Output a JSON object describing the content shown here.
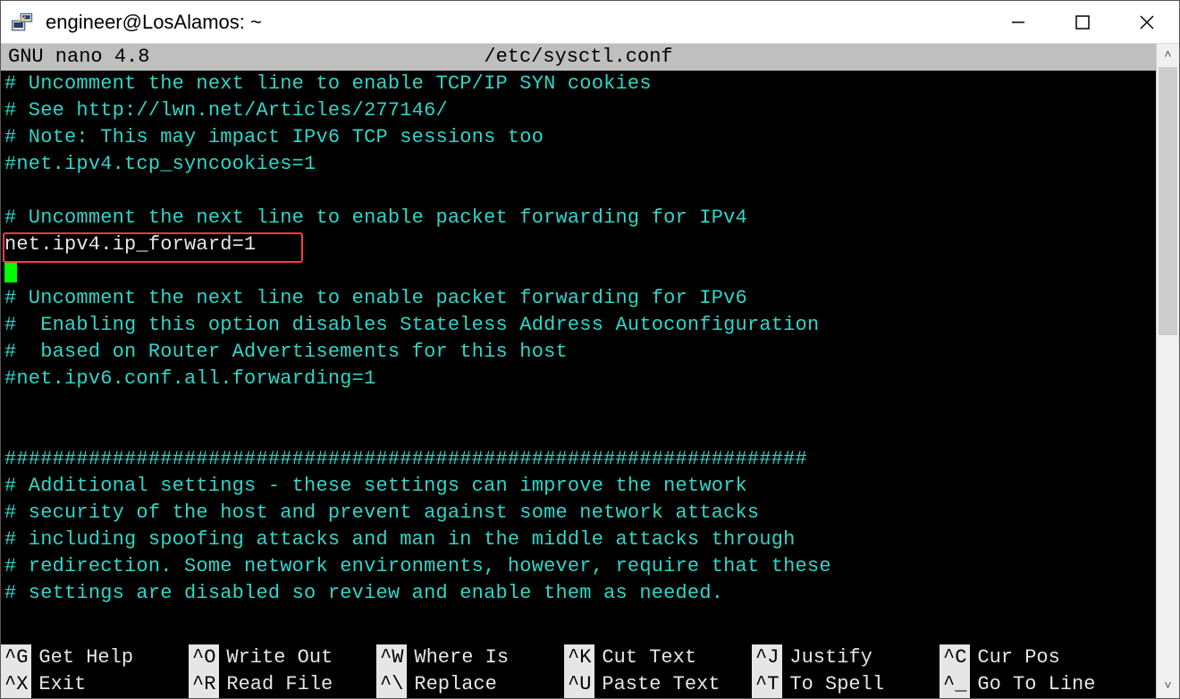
{
  "window": {
    "title": "engineer@LosAlamos: ~"
  },
  "editor": {
    "app": "  GNU nano 4.8",
    "filename": "/etc/sysctl.conf"
  },
  "lines": {
    "l1": "# Uncomment the next line to enable TCP/IP SYN cookies",
    "l2": "# See http://lwn.net/Articles/277146/",
    "l3": "# Note: This may impact IPv6 TCP sessions too",
    "l4": "#net.ipv4.tcp_syncookies=1",
    "l5": "",
    "l6": "# Uncomment the next line to enable packet forwarding for IPv4",
    "l7": "net.ipv4.ip_forward=1",
    "l8": "",
    "l9": "# Uncomment the next line to enable packet forwarding for IPv6",
    "l10": "#  Enabling this option disables Stateless Address Autoconfiguration",
    "l11": "#  based on Router Advertisements for this host",
    "l12": "#net.ipv6.conf.all.forwarding=1",
    "l13": "",
    "l14": "",
    "l15": "###################################################################",
    "l16": "# Additional settings - these settings can improve the network",
    "l17": "# security of the host and prevent against some network attacks",
    "l18": "# including spoofing attacks and man in the middle attacks through",
    "l19": "# redirection. Some network environments, however, require that these",
    "l20": "# settings are disabled so review and enable them as needed."
  },
  "shortcuts": {
    "row1": [
      {
        "key": "^G",
        "label": "Get Help"
      },
      {
        "key": "^O",
        "label": "Write Out"
      },
      {
        "key": "^W",
        "label": "Where Is"
      },
      {
        "key": "^K",
        "label": "Cut Text"
      },
      {
        "key": "^J",
        "label": "Justify"
      },
      {
        "key": "^C",
        "label": "Cur Pos"
      }
    ],
    "row2": [
      {
        "key": "^X",
        "label": "Exit"
      },
      {
        "key": "^R",
        "label": "Read File"
      },
      {
        "key": "^\\",
        "label": "Replace"
      },
      {
        "key": "^U",
        "label": "Paste Text"
      },
      {
        "key": "^T",
        "label": "To Spell"
      },
      {
        "key": "^_",
        "label": "Go To Line"
      }
    ]
  }
}
